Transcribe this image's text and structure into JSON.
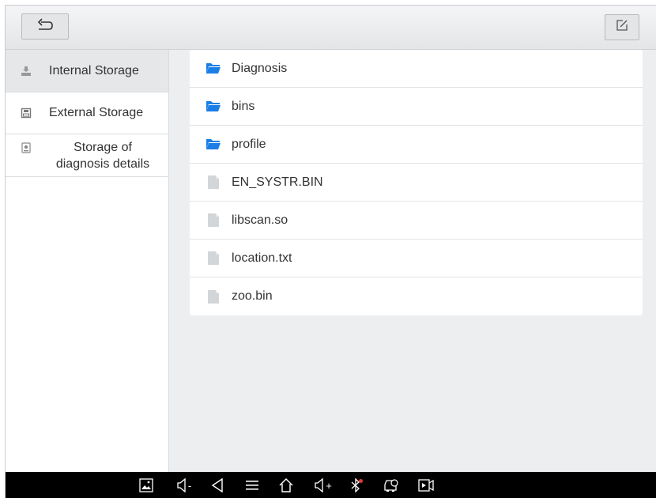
{
  "toolbar": {
    "back_icon": "back-arrow-icon",
    "edit_icon": "edit-icon"
  },
  "sidebar": {
    "items": [
      {
        "label": "Internal Storage",
        "icon": "internal-storage-icon",
        "active": true
      },
      {
        "label": "External Storage",
        "icon": "external-storage-icon",
        "active": false
      },
      {
        "label_line1": "Storage of",
        "label_line2": "diagnosis details",
        "icon": "diagnosis-storage-icon",
        "active": false
      }
    ]
  },
  "files": [
    {
      "name": "Diagnosis",
      "type": "folder"
    },
    {
      "name": "bins",
      "type": "folder"
    },
    {
      "name": "profile",
      "type": "folder"
    },
    {
      "name": "EN_SYSTR.BIN",
      "type": "file"
    },
    {
      "name": "libscan.so",
      "type": "file"
    },
    {
      "name": "location.txt",
      "type": "file"
    },
    {
      "name": "zoo.bin",
      "type": "file"
    }
  ],
  "navbar": {
    "icons": [
      "screenshot-icon",
      "volume-down-icon",
      "back-icon",
      "menu-icon",
      "home-icon",
      "volume-up-icon",
      "bluetooth-icon",
      "vci-icon",
      "screen-record-icon"
    ],
    "volume_down_label": "-",
    "volume_up_label": "+"
  },
  "colors": {
    "folder": "#1a7ee6",
    "file": "#d3d6d9",
    "background": "#eceef0",
    "navbar": "#000000",
    "bluetooth_dot": "#e53935"
  }
}
